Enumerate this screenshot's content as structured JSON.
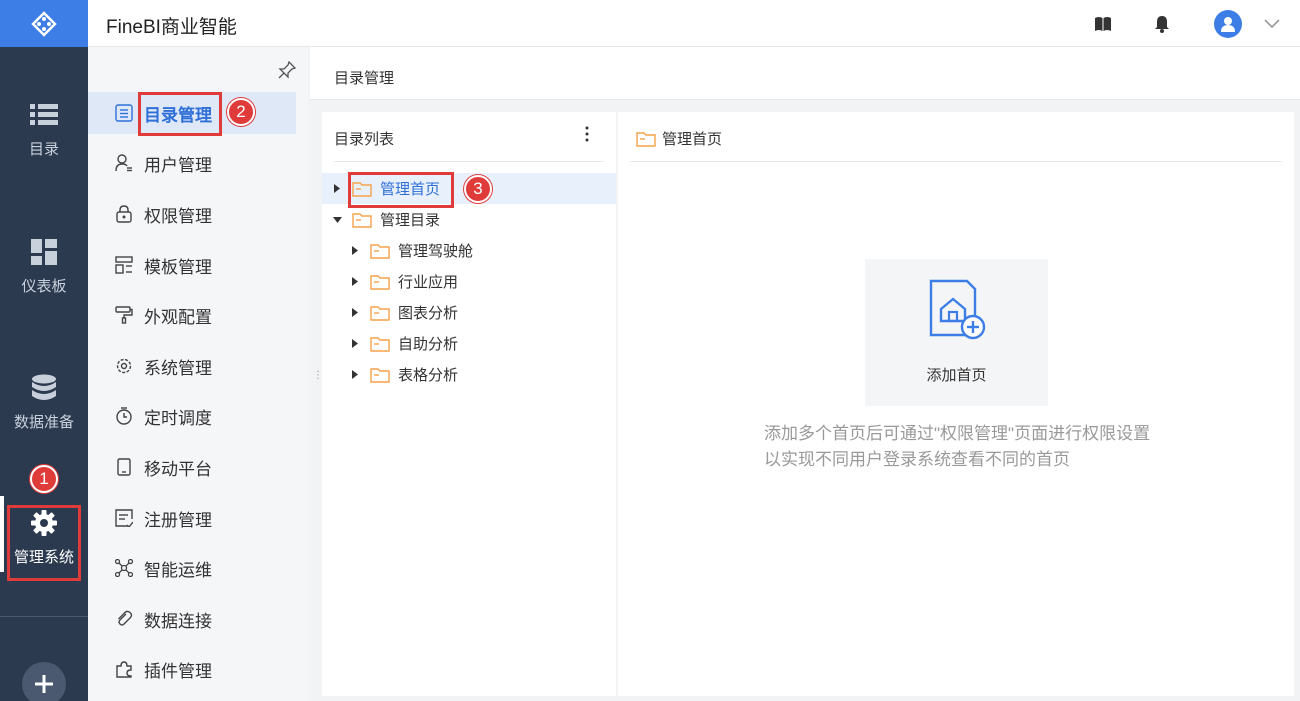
{
  "app": {
    "title": "FineBI商业智能"
  },
  "rail": {
    "items": [
      {
        "label": "目录",
        "icon": "list-icon"
      },
      {
        "label": "仪表板",
        "icon": "dashboard-icon"
      },
      {
        "label": "数据准备",
        "icon": "database-icon"
      },
      {
        "label": "管理系统",
        "icon": "gear-icon",
        "active": true
      }
    ],
    "add_label": "+"
  },
  "sidebar": {
    "items": [
      {
        "label": "目录管理",
        "icon": "catalog-icon",
        "active": true
      },
      {
        "label": "用户管理",
        "icon": "user-icon"
      },
      {
        "label": "权限管理",
        "icon": "lock-icon"
      },
      {
        "label": "模板管理",
        "icon": "template-icon"
      },
      {
        "label": "外观配置",
        "icon": "brush-icon"
      },
      {
        "label": "系统管理",
        "icon": "settings-icon"
      },
      {
        "label": "定时调度",
        "icon": "timer-icon"
      },
      {
        "label": "移动平台",
        "icon": "mobile-icon"
      },
      {
        "label": "注册管理",
        "icon": "register-icon"
      },
      {
        "label": "智能运维",
        "icon": "network-icon"
      },
      {
        "label": "数据连接",
        "icon": "link-icon"
      },
      {
        "label": "插件管理",
        "icon": "plugin-icon"
      }
    ]
  },
  "breadcrumb": {
    "label": "目录管理"
  },
  "tree": {
    "header": "目录列表",
    "nodes": [
      {
        "label": "管理首页",
        "level": 0,
        "expanded": false,
        "selected": true
      },
      {
        "label": "管理目录",
        "level": 0,
        "expanded": true
      },
      {
        "label": "管理驾驶舱",
        "level": 1,
        "expanded": false
      },
      {
        "label": "行业应用",
        "level": 1,
        "expanded": false
      },
      {
        "label": "图表分析",
        "level": 1,
        "expanded": false
      },
      {
        "label": "自助分析",
        "level": 1,
        "expanded": false
      },
      {
        "label": "表格分析",
        "level": 1,
        "expanded": false
      }
    ]
  },
  "detail": {
    "title": "管理首页",
    "add_label": "添加首页",
    "hint": "添加多个首页后可通过\"权限管理\"页面进行权限设置以实现不同用户登录系统查看不同的首页"
  },
  "annotations": {
    "badge1": "1",
    "badge2": "2",
    "badge3": "3"
  },
  "colors": {
    "accent": "#3d7ee6",
    "rail": "#2c3a4f",
    "folder": "#f5a24b",
    "annotation": "#e03b3b"
  }
}
